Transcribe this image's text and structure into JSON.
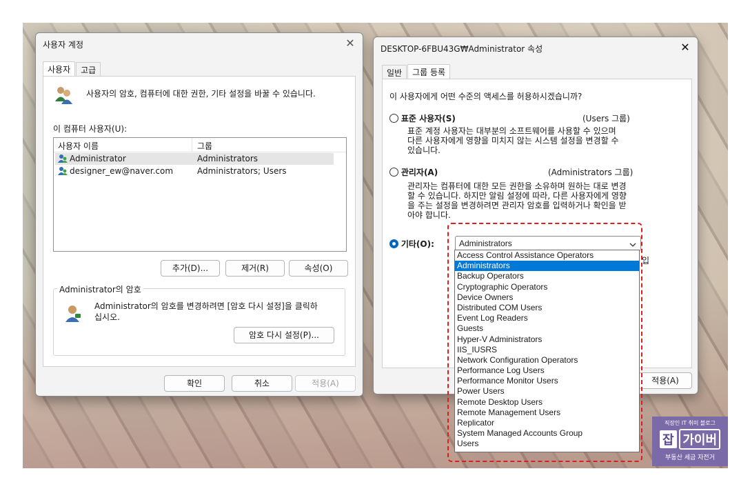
{
  "left_window": {
    "title": "사용자 계정",
    "close_glyph": "✕",
    "tabs": [
      "사용자",
      "고급"
    ],
    "description": "사용자의 암호, 컴퓨터에 대한 권한, 기타 설정을 바꿀 수 있습니다.",
    "list_label": "이 컴퓨터 사용자(U):",
    "columns": [
      "사용자 이름",
      "그룹"
    ],
    "users": [
      {
        "name": "Administrator",
        "group": "Administrators"
      },
      {
        "name": "designer_ew@naver.com",
        "group": "Administrators; Users"
      }
    ],
    "buttons": {
      "add": "추가(D)...",
      "remove": "제거(R)",
      "properties": "속성(O)"
    },
    "password_group_title": "Administrator의 암호",
    "password_text_1": "Administrator의 암호를 변경하려면 [암호 다시 설정]을 클릭하",
    "password_text_2": "십시오.",
    "reset_button": "암호 다시 설정(P)...",
    "ok": "확인",
    "cancel": "취소",
    "apply": "적용(A)"
  },
  "right_window": {
    "title": "DESKTOP-6FBU43G₩Administrator 속성",
    "close_glyph": "✕",
    "tabs": [
      "일반",
      "그룹 등록"
    ],
    "question": "이 사용자에게 어떤 수준의 액세스를 허용하시겠습니까?",
    "standard": {
      "label": "표준 사용자(S)",
      "group": "(Users 그룹)",
      "desc": [
        "표준 계정 사용자는 대부분의 소프트웨어를 사용할 수 있으며",
        "다른 사용자에게 영향을 미치지 않는 시스템 설정을 변경할 수",
        "있습니다."
      ]
    },
    "admin": {
      "label": "관리자(A)",
      "group": "(Administrators 그룹)",
      "desc": [
        "관리자는 컴퓨터에 대한 모든 권한을 소유하며 원하는 대로 변경",
        "할 수 있습니다. 하지만 알림 설정에 따라, 다른 사용자에게 영향",
        "을 주는 설정을 변경하려면 관리자 암호를 입력하거나 확인을 받",
        "아야 합니다."
      ]
    },
    "other": {
      "label": "기타(O):",
      "selected": "Administrators",
      "trailing_text": "입"
    },
    "dropdown_options": [
      "Access Control Assistance Operators",
      "Administrators",
      "Backup Operators",
      "Cryptographic Operators",
      "Device Owners",
      "Distributed COM Users",
      "Event Log Readers",
      "Guests",
      "Hyper-V Administrators",
      "IIS_IUSRS",
      "Network Configuration Operators",
      "Performance Log Users",
      "Performance Monitor Users",
      "Power Users",
      "Remote Desktop Users",
      "Remote Management Users",
      "Replicator",
      "System Managed Accounts Group",
      "Users"
    ],
    "highlighted_option": "Administrators",
    "apply": "적용(A)"
  },
  "watermark": {
    "line1": "직장인 IT 취미 블로그",
    "big_left": "잡",
    "big_right": "가이버",
    "line3": "부동산 세금 자전거"
  },
  "colors": {
    "accent": "#0078d7",
    "highlight_border": "#e01c1c"
  }
}
